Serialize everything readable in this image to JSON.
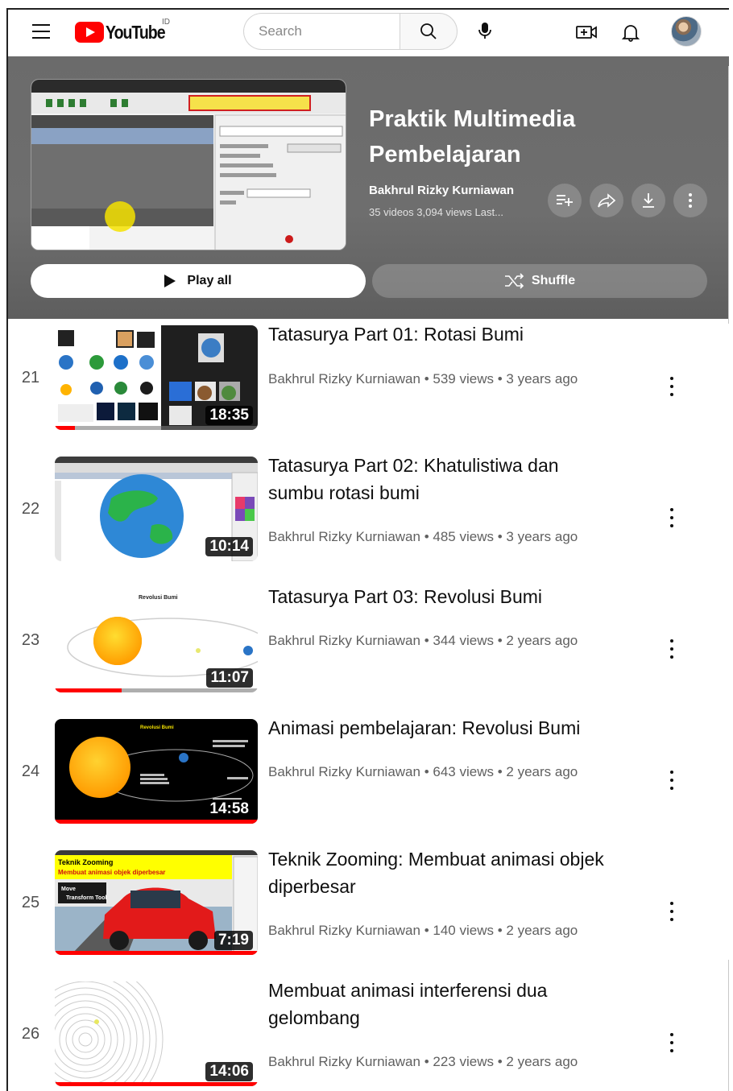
{
  "topbar": {
    "logo_text": "YouTube",
    "country_code": "ID",
    "search_placeholder": "Search"
  },
  "playlist": {
    "title_line1": "Praktik Multimedia",
    "title_line2": "Pembelajaran",
    "owner": "Bakhrul Rizky Kurniawan",
    "stats": "35 videos  3,094 views  Last...",
    "play_all_label": "Play all",
    "shuffle_label": "Shuffle"
  },
  "videos": [
    {
      "index": "21",
      "title_lines": [
        "Tatasurya Part 01: Rotasi Bumi"
      ],
      "channel": "Bakhrul Rizky Kurniawan",
      "views": "539 views",
      "age": "3 years ago",
      "duration": "18:35",
      "watched_fraction": 0.1
    },
    {
      "index": "22",
      "title_lines": [
        "Tatasurya Part 02: Khatulistiwa dan",
        "sumbu rotasi bumi"
      ],
      "channel": "Bakhrul Rizky Kurniawan",
      "views": "485 views",
      "age": "3 years ago",
      "duration": "10:14",
      "watched_fraction": 0.0
    },
    {
      "index": "23",
      "title_lines": [
        "Tatasurya Part 03: Revolusi Bumi"
      ],
      "channel": "Bakhrul Rizky Kurniawan",
      "views": "344 views",
      "age": "2 years ago",
      "duration": "11:07",
      "watched_fraction": 0.33
    },
    {
      "index": "24",
      "title_lines": [
        "Animasi pembelajaran: Revolusi Bumi"
      ],
      "channel": "Bakhrul Rizky Kurniawan",
      "views": "643 views",
      "age": "2 years ago",
      "duration": "14:58",
      "watched_fraction": 1.0
    },
    {
      "index": "25",
      "title_lines": [
        "Teknik Zooming: Membuat animasi objek",
        "diperbesar"
      ],
      "channel": "Bakhrul Rizky Kurniawan",
      "views": "140 views",
      "age": "2 years ago",
      "duration": "7:19",
      "watched_fraction": 1.0
    },
    {
      "index": "26",
      "title_lines": [
        "Membuat animasi interferensi dua",
        "gelombang"
      ],
      "channel": "Bakhrul Rizky Kurniawan",
      "views": "223 views",
      "age": "2 years ago",
      "duration": "14:06",
      "watched_fraction": 1.0
    }
  ],
  "thumb_text": {
    "rev_title": "Revolusi Bumi",
    "zoom_title": "Teknik Zooming",
    "zoom_sub": "Membuat animasi objek diperbesar",
    "zoom_move": "Move",
    "zoom_tool": "Transform Tool"
  },
  "colors": {
    "brand_red": "#ff0000",
    "header_bg": "#6b6b6b",
    "meta_text": "#606060"
  }
}
